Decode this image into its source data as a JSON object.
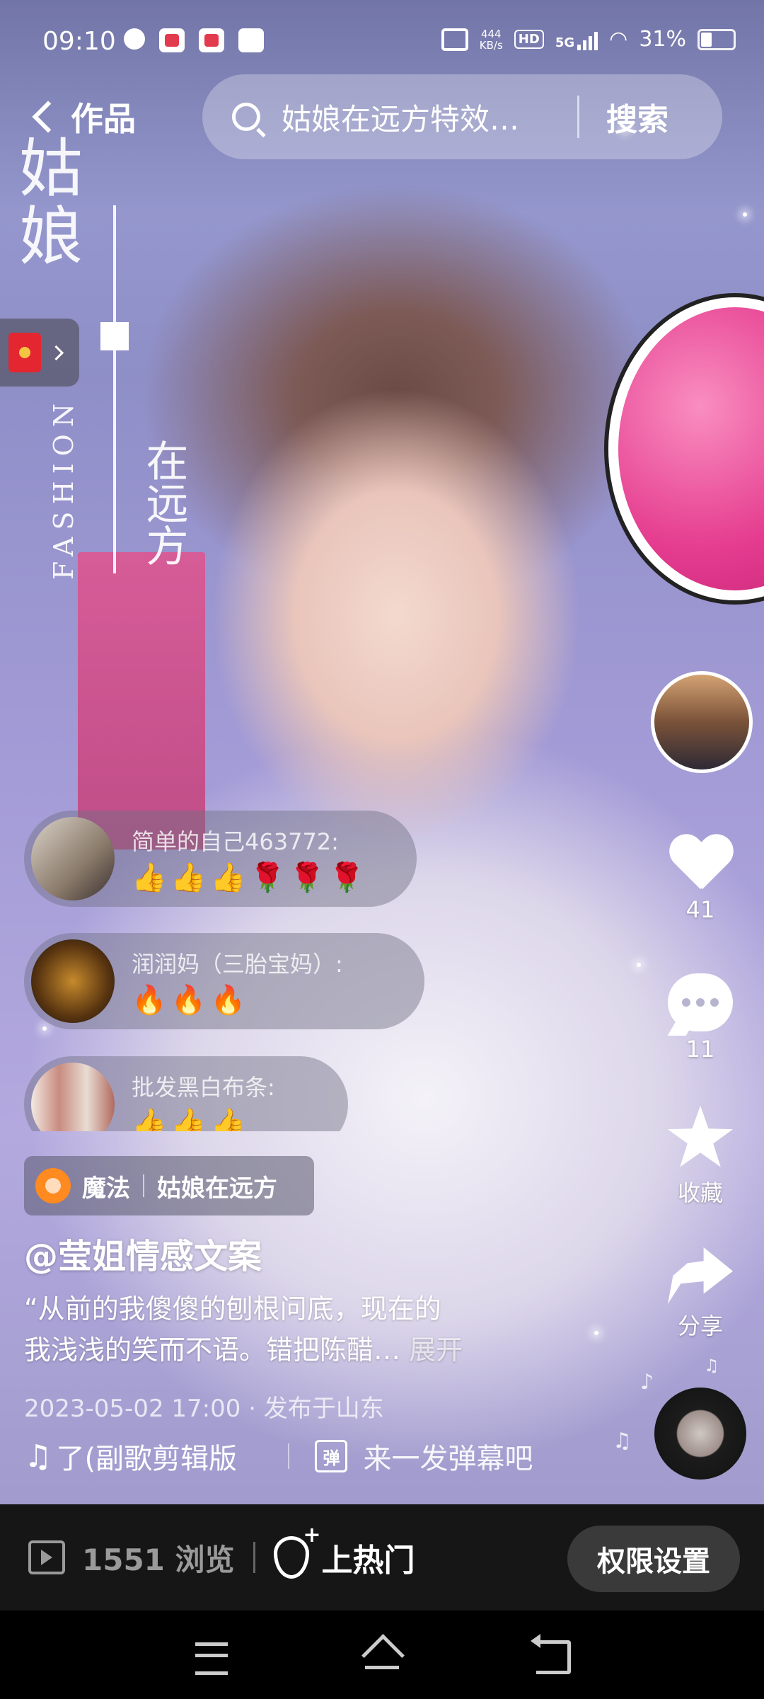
{
  "status_bar": {
    "time": "09:10",
    "net_speed_value": "444",
    "net_speed_unit": "KB/s",
    "hd": "HD",
    "network": "5G",
    "battery_percent": "31%",
    "battery_level": 0.31
  },
  "header": {
    "back_label": "作品",
    "search_query": "姑娘在远方特效…",
    "search_button": "搜索"
  },
  "video_overlay_text": {
    "vertical_title": "姑娘",
    "vertical_sub": "在远方",
    "fashion": "FASHION"
  },
  "barrage": [
    {
      "user": "简单的自己463772:",
      "message": "👍👍👍🌹🌹🌹"
    },
    {
      "user": "润润妈（三胎宝妈）:",
      "message": "🔥🔥🔥"
    },
    {
      "user": "批发黑白布条:",
      "message": "👍👍👍"
    }
  ],
  "effect_tag": {
    "type": "魔法",
    "name": "姑娘在远方"
  },
  "author": "@莹姐情感文案",
  "description": {
    "line1": "“从前的我傻傻的刨根问底，现在的",
    "line2": "我浅浅的笑而不语。错把陈醋… ",
    "expand": "展开"
  },
  "meta": "2023-05-02 17:00  ·  发布于山东",
  "music": {
    "title": "了(副歌剪辑版"
  },
  "danmu": {
    "icon_text": "弹",
    "placeholder": "来一发弹幕吧"
  },
  "actions": {
    "likes": "41",
    "comments": "11",
    "favorite": "收藏",
    "share": "分享"
  },
  "bottom_bar": {
    "views": "1551 浏览",
    "hot": "上热门",
    "permissions": "权限设置"
  },
  "icons": {
    "back": "chevron-left-icon",
    "search": "search-icon",
    "like": "heart-icon",
    "comment": "comment-icon",
    "favorite": "star-icon",
    "share": "share-icon",
    "music": "music-note-icon",
    "red_packet": "red-envelope-icon"
  },
  "colors": {
    "accent_orange": "#ff8a1f",
    "bottom_bar_bg": "#161616",
    "button_bg": "#3a3a3a"
  }
}
